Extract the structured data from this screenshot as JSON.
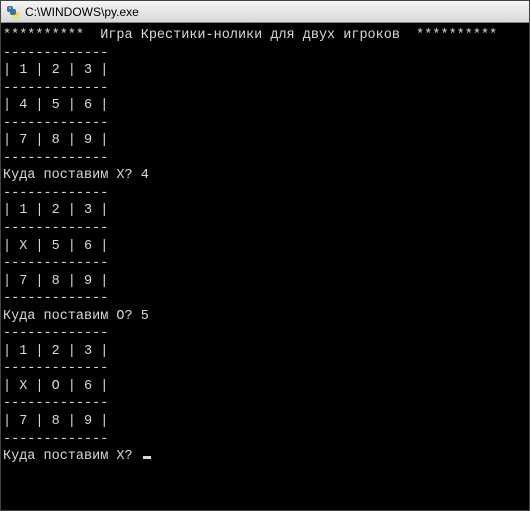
{
  "titlebar": {
    "icon_name": "python-icon",
    "title": "C:\\WINDOWS\\py.exe"
  },
  "terminal": {
    "header": "**********  Игра Крестики-нолики для двух игроков  **********",
    "sep": "-------------",
    "boards": [
      {
        "rows": [
          "| 1 | 2 | 3 |",
          "| 4 | 5 | 6 |",
          "| 7 | 8 | 9 |"
        ]
      },
      {
        "prompt_line": "Куда поставим X? 4",
        "rows": [
          "| 1 | 2 | 3 |",
          "| X | 5 | 6 |",
          "| 7 | 8 | 9 |"
        ]
      },
      {
        "prompt_line": "Куда поставим O? 5",
        "rows": [
          "| 1 | 2 | 3 |",
          "| X | O | 6 |",
          "| 7 | 8 | 9 |"
        ]
      }
    ],
    "current_prompt": "Куда поставим X? "
  }
}
